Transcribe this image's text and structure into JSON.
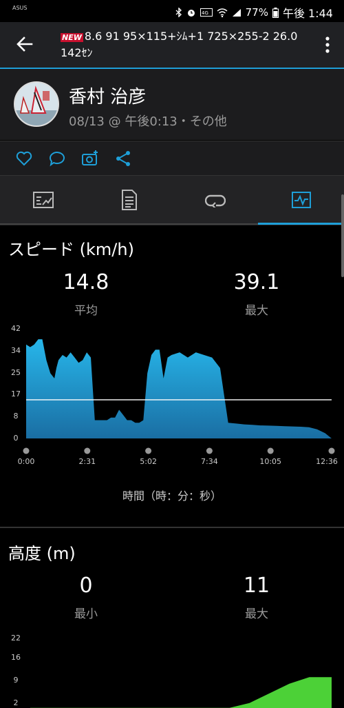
{
  "status_bar": {
    "left_icon": "app-icon",
    "battery": "77%",
    "time": "午後 1:44"
  },
  "toolbar": {
    "badge": "NEW",
    "title": "8.6 91 95×115+ｼﾑ+1 725×255-2 26.0 142ｾﾝ"
  },
  "profile": {
    "name": "香村 治彦",
    "subtitle": "08/13 @ 午後0:13・その他"
  },
  "actions": [
    "heart-icon",
    "comment-icon",
    "camera-plus-icon",
    "share-icon"
  ],
  "tabs": [
    "summary-icon",
    "details-icon",
    "laps-icon",
    "charts-icon"
  ],
  "speed": {
    "title": "スピード (km/h)",
    "avg_value": "14.8",
    "avg_label": "平均",
    "max_value": "39.1",
    "max_label": "最大",
    "x_caption": "時間（時：分：秒）"
  },
  "altitude": {
    "title": "高度 (m)",
    "min_value": "0",
    "min_label": "最小",
    "max_value": "11",
    "max_label": "最大"
  },
  "colors": {
    "accent": "#1e9fd8",
    "speed_fill_top": "#27b6ea",
    "speed_fill_bottom": "#1a6ea3",
    "altitude_fill": "#4cd137"
  },
  "chart_data": [
    {
      "type": "area",
      "title": "スピード (km/h)",
      "xlabel": "時間（時：分：秒）",
      "x_ticks": [
        "0:00",
        "2:31",
        "5:02",
        "7:34",
        "10:05",
        "12:36"
      ],
      "y_ticks": [
        "0",
        "8",
        "17",
        "25",
        "34",
        "42"
      ],
      "ylim": [
        0,
        42
      ],
      "avg_line": 14.8,
      "x": [
        0,
        10,
        20,
        30,
        40,
        50,
        60,
        70,
        75,
        80,
        90,
        100,
        110,
        120,
        130,
        140,
        150,
        160,
        170,
        180,
        190,
        200,
        210,
        220,
        230,
        240,
        250,
        260,
        270,
        280,
        290,
        300,
        310,
        320,
        330,
        340,
        350,
        360,
        380,
        400,
        420,
        440,
        460,
        480,
        500,
        520,
        540,
        560,
        580,
        600,
        620,
        640,
        660,
        680,
        700,
        720,
        740,
        756
      ],
      "y": [
        36,
        35,
        36,
        38,
        38,
        30,
        25,
        23,
        27,
        30,
        32,
        31,
        33,
        31,
        29,
        30,
        33,
        31,
        7,
        7,
        7,
        7,
        8,
        8,
        11,
        9,
        7,
        7,
        6,
        6,
        7,
        25,
        32,
        34,
        34,
        23,
        31,
        32,
        33,
        31,
        33,
        32,
        31,
        27,
        6,
        5.7,
        5.4,
        5.2,
        5,
        4.9,
        4.8,
        4.7,
        4.6,
        4.5,
        4.3,
        3.5,
        2,
        0
      ]
    },
    {
      "type": "area",
      "title": "高度 (m)",
      "y_ticks": [
        "2",
        "9",
        "16",
        "22"
      ],
      "ylim": [
        0,
        24
      ],
      "x": [
        0,
        100,
        200,
        300,
        400,
        450,
        500,
        550,
        600,
        650,
        700,
        756
      ],
      "y": [
        0.5,
        0.5,
        0.5,
        0.5,
        0.5,
        0.5,
        0.5,
        2,
        5,
        8,
        10,
        10
      ]
    }
  ]
}
